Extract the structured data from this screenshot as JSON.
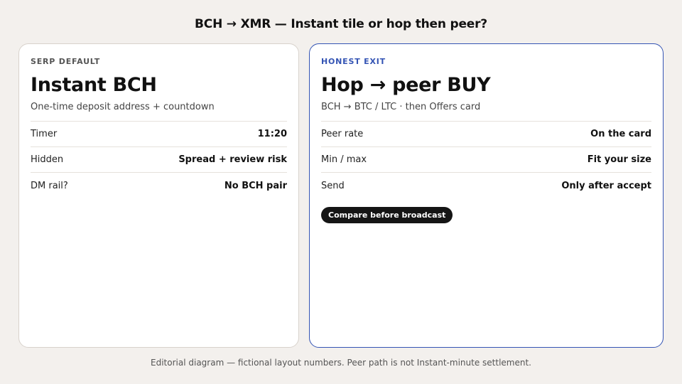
{
  "title": "BCH → XMR — Instant tile or hop then peer?",
  "left_card": {
    "eyebrow": "SERP DEFAULT",
    "title": "Instant BCH",
    "subtitle": "One-time deposit address + countdown",
    "rows": [
      {
        "key": "Timer",
        "value": "11:20"
      },
      {
        "key": "Hidden",
        "value": "Spread + review risk"
      },
      {
        "key": "DM rail?",
        "value": "No BCH pair"
      }
    ]
  },
  "right_card": {
    "eyebrow": "HONEST EXIT",
    "title": "Hop → peer BUY",
    "subtitle": "BCH → BTC / LTC · then Offers card",
    "rows": [
      {
        "key": "Peer rate",
        "value": "On the card"
      },
      {
        "key": "Min / max",
        "value": "Fit your size"
      },
      {
        "key": "Send",
        "value": "Only after accept"
      }
    ],
    "button_label": "Compare before broadcast"
  },
  "footer": "Editorial diagram — fictional layout numbers. Peer path is not Instant-minute settlement.",
  "colors": {
    "background": "#f3f0ed",
    "accent": "#3454b4",
    "button": "#151515"
  }
}
